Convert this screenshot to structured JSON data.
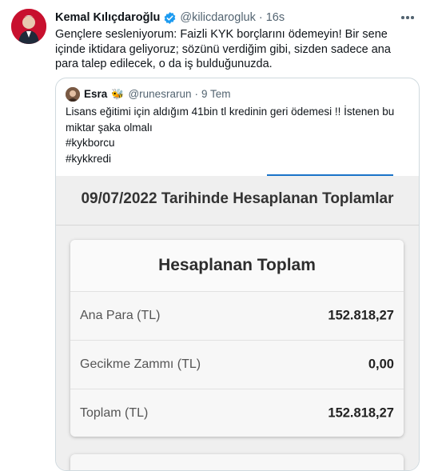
{
  "tweet": {
    "author_name": "Kemal Kılıçdaroğlu",
    "handle": "@kilicdarogluk",
    "separator": "·",
    "time": "16s",
    "verified_icon": "verified-badge-icon",
    "more_icon": "more-options-icon",
    "text": "Gençlere sesleniyorum: Faizli KYK borçlarını ödemeyin! Bir sene içinde iktidara geliyoruz; sözünü verdiğim gibi, sizden sadece ana para talep edilecek, o da iş bulduğunuzda."
  },
  "quote": {
    "author_name": "Esra",
    "emoji": "🐝",
    "handle": "@runesrarun",
    "separator": "·",
    "time": "9 Tem",
    "lines": [
      "Lisans eğitimi için aldığım 41bin tl kredinin geri ödemesi !! İstenen bu",
      "miktar şaka olmalı",
      "#kykborcu",
      "#kykkredi"
    ]
  },
  "calculation": {
    "heading": "09/07/2022 Tarihinde Hesaplanan Toplamlar",
    "card_title": "Hesaplanan Toplam",
    "rows": [
      {
        "label": "Ana Para (TL)",
        "value": "152.818,27"
      },
      {
        "label": "Gecikme Zammı (TL)",
        "value": "0,00"
      },
      {
        "label": "Toplam (TL)",
        "value": "152.818,27"
      }
    ]
  },
  "colors": {
    "accent": "#1d9bf0",
    "tab_underline": "#1a73c8",
    "muted_text": "#536471"
  }
}
